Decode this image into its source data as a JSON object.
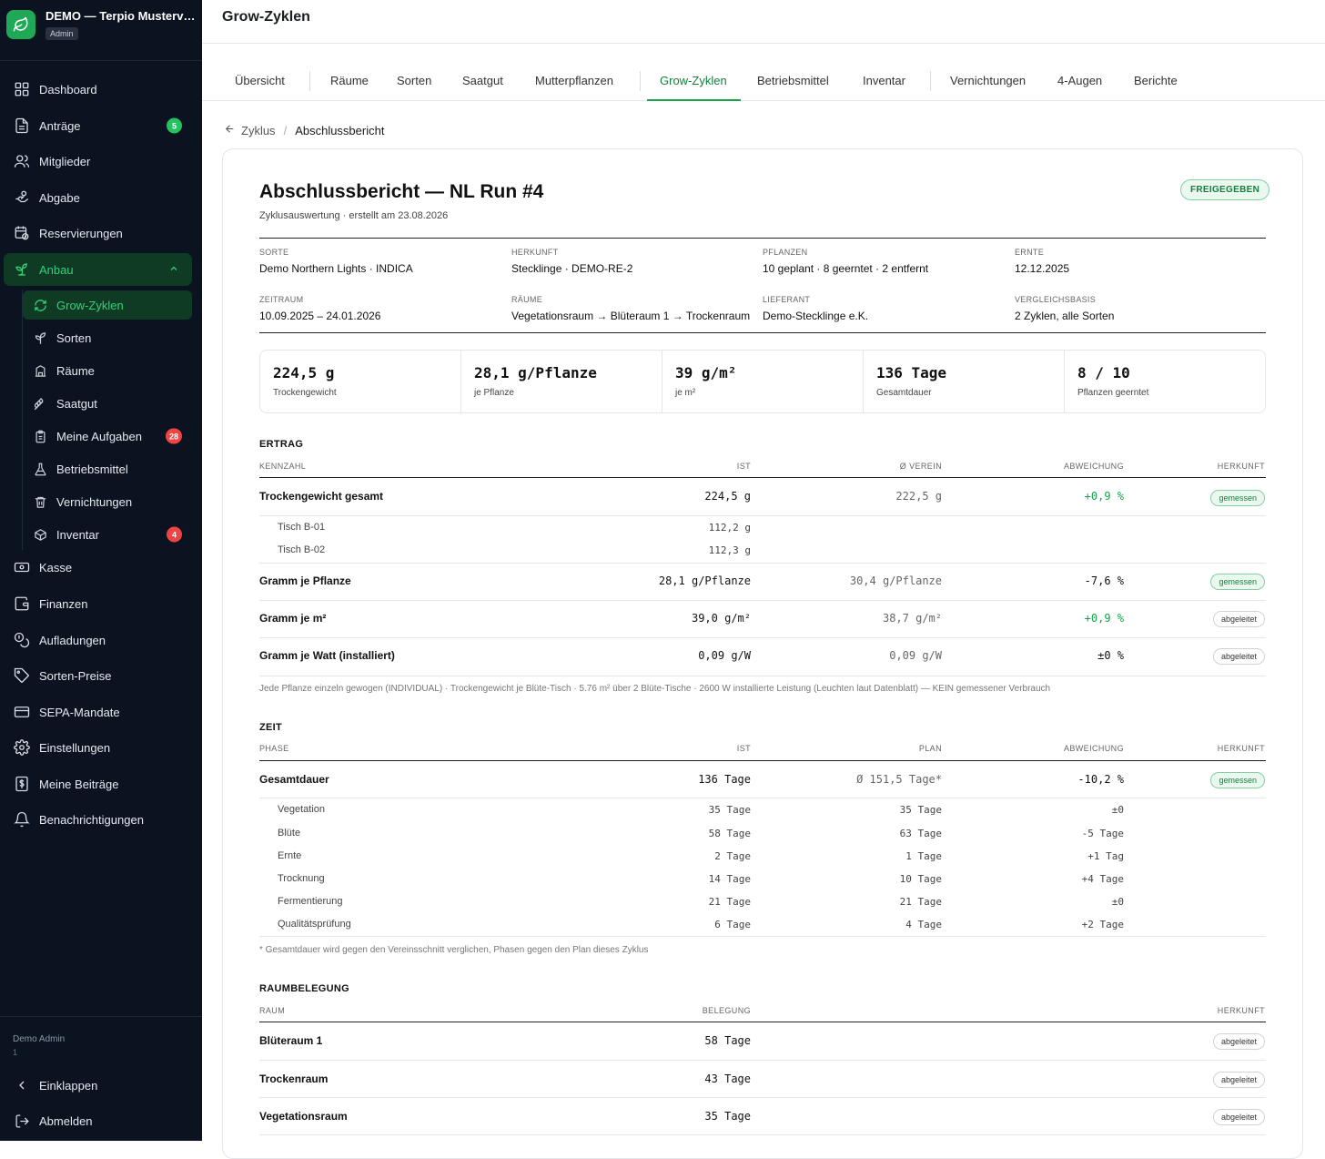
{
  "sidebar": {
    "brand_title": "DEMO — Terpio Musterverein",
    "brand_badge": "Admin",
    "items": [
      {
        "label": "Dashboard"
      },
      {
        "label": "Anträge",
        "count": "5"
      },
      {
        "label": "Mitglieder"
      },
      {
        "label": "Abgabe"
      },
      {
        "label": "Reservierungen"
      },
      {
        "label": "Anbau"
      },
      {
        "label": "Kasse"
      },
      {
        "label": "Finanzen"
      },
      {
        "label": "Aufladungen"
      },
      {
        "label": "Sorten-Preise"
      },
      {
        "label": "SEPA-Mandate"
      },
      {
        "label": "Einstellungen"
      },
      {
        "label": "Meine Beiträge"
      },
      {
        "label": "Benachrichtigungen"
      }
    ],
    "sub_items": [
      {
        "label": "Grow-Zyklen"
      },
      {
        "label": "Sorten"
      },
      {
        "label": "Räume"
      },
      {
        "label": "Saatgut"
      },
      {
        "label": "Meine Aufgaben",
        "count": "28"
      },
      {
        "label": "Betriebsmittel"
      },
      {
        "label": "Vernichtungen"
      },
      {
        "label": "Inventar",
        "count": "4"
      }
    ],
    "user_name": "Demo Admin",
    "user_sub": "1",
    "collapse_label": "Einklappen",
    "logout_label": "Abmelden"
  },
  "header": {
    "title": "Grow-Zyklen"
  },
  "tabs": [
    "Übersicht",
    "Räume",
    "Sorten",
    "Saatgut",
    "Mutterpflanzen",
    "Grow-Zyklen",
    "Betriebsmittel",
    "Inventar",
    "Vernichtungen",
    "4-Augen",
    "Berichte"
  ],
  "breadcrumb": {
    "back": "Zyklus",
    "current": "Abschlussbericht"
  },
  "report": {
    "title": "Abschlussbericht — NL Run #4",
    "subtitle": "Zyklusauswertung · erstellt am 23.08.2026",
    "status": "FREIGEGEBEN",
    "meta": [
      {
        "label": "SORTE",
        "value": "Demo Northern Lights · INDICA"
      },
      {
        "label": "HERKUNFT",
        "value": "Stecklinge · DEMO-RE-2"
      },
      {
        "label": "PFLANZEN",
        "value": "10 geplant · 8 geerntet · 2 entfernt"
      },
      {
        "label": "ERNTE",
        "value": "12.12.2025"
      },
      {
        "label": "ZEITRAUM",
        "value": "10.09.2025 – 24.01.2026"
      },
      {
        "label": "RÄUME",
        "value": "Vegetationsraum → Blüteraum 1 → Trockenraum"
      },
      {
        "label": "LIEFERANT",
        "value": "Demo-Stecklinge e.K."
      },
      {
        "label": "VERGLEICHSBASIS",
        "value": "2 Zyklen, alle Sorten"
      }
    ],
    "kpis": [
      {
        "value": "224,5 g",
        "label": "Trockengewicht"
      },
      {
        "value": "28,1 g/Pflanze",
        "label": "je Pflanze"
      },
      {
        "value": "39 g/m²",
        "label": "je m²"
      },
      {
        "value": "136 Tage",
        "label": "Gesamtdauer"
      },
      {
        "value": "8 / 10",
        "label": "Pflanzen geerntet"
      }
    ],
    "yield": {
      "title": "ERTRAG",
      "headers": [
        "KENNZAHL",
        "IST",
        "Ø VEREIN",
        "ABWEICHUNG",
        "HERKUNFT"
      ],
      "rows": [
        {
          "name": "Trockengewicht gesamt",
          "ist": "224,5 g",
          "avg": "222,5 g",
          "dev": "+0,9 %",
          "src": "gemessen"
        },
        {
          "name": "Tisch B-01",
          "ist": "112,2 g"
        },
        {
          "name": "Tisch B-02",
          "ist": "112,3 g"
        },
        {
          "name": "Gramm je Pflanze",
          "ist": "28,1 g/Pflanze",
          "avg": "30,4 g/Pflanze",
          "dev": "-7,6 %",
          "src": "gemessen"
        },
        {
          "name": "Gramm je m²",
          "ist": "39,0 g/m²",
          "avg": "38,7 g/m²",
          "dev": "+0,9 %",
          "src": "abgeleitet"
        },
        {
          "name": "Gramm je Watt (installiert)",
          "ist": "0,09 g/W",
          "avg": "0,09 g/W",
          "dev": "±0 %",
          "src": "abgeleitet"
        }
      ],
      "note": "Jede Pflanze einzeln gewogen (INDIVIDUAL) · Trockengewicht je Blüte-Tisch · 5.76 m² über 2 Blüte-Tische · 2600 W installierte Leistung (Leuchten laut Datenblatt) — KEIN gemessener Verbrauch"
    },
    "time": {
      "title": "ZEIT",
      "headers": [
        "PHASE",
        "IST",
        "PLAN",
        "ABWEICHUNG",
        "HERKUNFT"
      ],
      "total": {
        "name": "Gesamtdauer",
        "ist": "136 Tage",
        "plan": "Ø 151,5 Tage*",
        "dev": "-10,2 %",
        "src": "gemessen"
      },
      "phases": [
        {
          "name": "Vegetation",
          "ist": "35 Tage",
          "plan": "35 Tage",
          "dev": "±0"
        },
        {
          "name": "Blüte",
          "ist": "58 Tage",
          "plan": "63 Tage",
          "dev": "-5 Tage"
        },
        {
          "name": "Ernte",
          "ist": "2 Tage",
          "plan": "1 Tage",
          "dev": "+1 Tag"
        },
        {
          "name": "Trocknung",
          "ist": "14 Tage",
          "plan": "10 Tage",
          "dev": "+4 Tage"
        },
        {
          "name": "Fermentierung",
          "ist": "21 Tage",
          "plan": "21 Tage",
          "dev": "±0"
        },
        {
          "name": "Qualitätsprüfung",
          "ist": "6 Tage",
          "plan": "4 Tage",
          "dev": "+2 Tage"
        }
      ],
      "note": "* Gesamtdauer wird gegen den Vereinsschnitt verglichen, Phasen gegen den Plan dieses Zyklus"
    },
    "rooms": {
      "title": "RAUMBELEGUNG",
      "headers": [
        "RAUM",
        "BELEGUNG",
        "HERKUNFT"
      ],
      "rows": [
        {
          "name": "Blüteraum 1",
          "days": "58 Tage",
          "src": "abgeleitet"
        },
        {
          "name": "Trockenraum",
          "days": "43 Tage",
          "src": "abgeleitet"
        },
        {
          "name": "Vegetationsraum",
          "days": "35 Tage",
          "src": "abgeleitet"
        }
      ]
    }
  },
  "colors": {
    "accent": "#16a34a",
    "sidebar_bg": "#0b1220",
    "active_bg": "#0f3b24",
    "badge_red": "#ef4444"
  }
}
